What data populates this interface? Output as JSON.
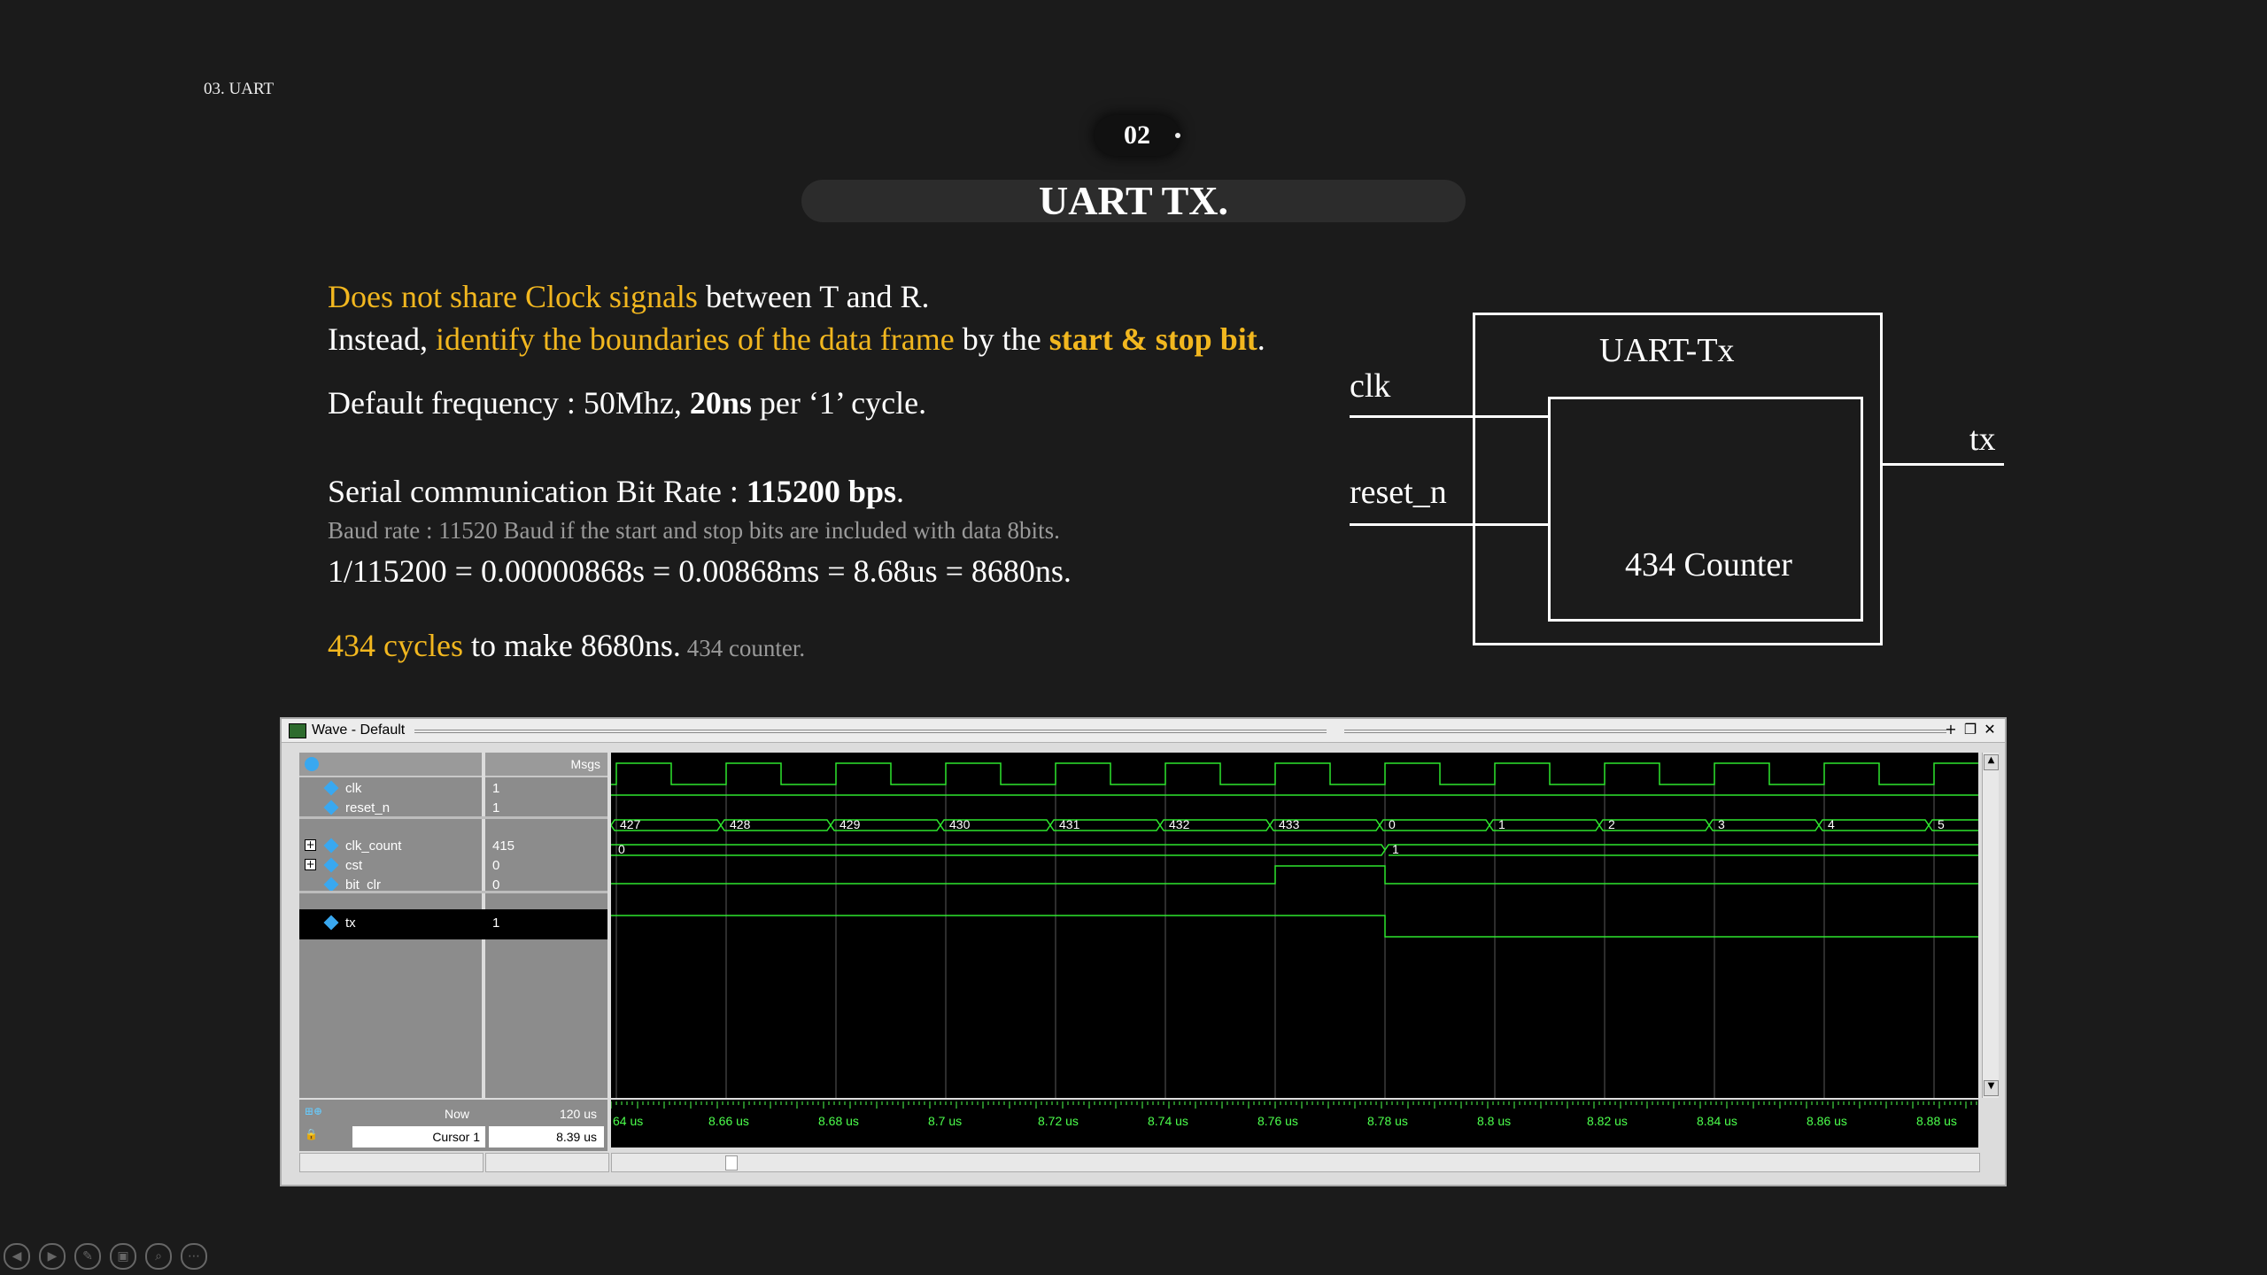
{
  "slide": {
    "section_label": "03. UART",
    "number": "02",
    "title": "UART TX."
  },
  "body": {
    "line1_highlight": "Does not share Clock signals",
    "line1_rest": " between T and R.",
    "line2_a": "Instead, ",
    "line2_highlight": "identify the boundaries of  the data frame",
    "line2_b": " by the ",
    "line2_bold": "start & stop bit",
    "line2_end": ".",
    "line3_a": "Default frequency : 50Mhz, ",
    "line3_bold": "20ns",
    "line3_b": " per ‘1’ cycle.",
    "line4_a": "Serial communication Bit Rate : ",
    "line4_bold": "115200 bps",
    "line4_end": ".",
    "line5": "Baud rate : 11520 Baud if  the start and stop bits are included with data 8bits.",
    "line6": "1/115200 = 0.00000868s = 0.00868ms = 8.68us = 8680ns.",
    "line7_highlight": "434 cycles",
    "line7_rest": " to make 8680ns.",
    "line7_small": " 434 counter."
  },
  "diagram": {
    "outer_label": "UART-Tx",
    "inner_label": "434 Counter",
    "input_clk": "clk",
    "input_reset": "reset_n",
    "output_tx": "tx"
  },
  "wave": {
    "window_title": "Wave - Default",
    "msgs_header": "Msgs",
    "signals": [
      {
        "name": "clk",
        "value": "1"
      },
      {
        "name": "reset_n",
        "value": "1"
      },
      {
        "name": "clk_count",
        "value": "415"
      },
      {
        "name": "cst",
        "value": "0"
      },
      {
        "name": "bit_clr",
        "value": "0"
      },
      {
        "name": "tx",
        "value": "1"
      }
    ],
    "clk_count_segments": [
      "427",
      "428",
      "429",
      "430",
      "431",
      "432",
      "433",
      "0",
      "1",
      "2",
      "3",
      "4",
      "5"
    ],
    "cst_segments": [
      "0",
      "1"
    ],
    "now_label": "Now",
    "now_value": "120 us",
    "cursor_label": "Cursor 1",
    "cursor_value": "8.39 us",
    "time_ticks": [
      "64 us",
      "8.66 us",
      "8.68 us",
      "8.7 us",
      "8.72 us",
      "8.74 us",
      "8.76 us",
      "8.78 us",
      "8.8 us",
      "8.82 us",
      "8.84 us",
      "8.86 us",
      "8.88 us"
    ],
    "colors": {
      "signal": "#2ee62e",
      "grid": "#5a5a5a",
      "background": "#000000"
    }
  },
  "nav": {
    "icons": [
      "prev-icon",
      "next-icon",
      "pen-icon",
      "slides-icon",
      "zoom-icon",
      "more-icon"
    ]
  }
}
